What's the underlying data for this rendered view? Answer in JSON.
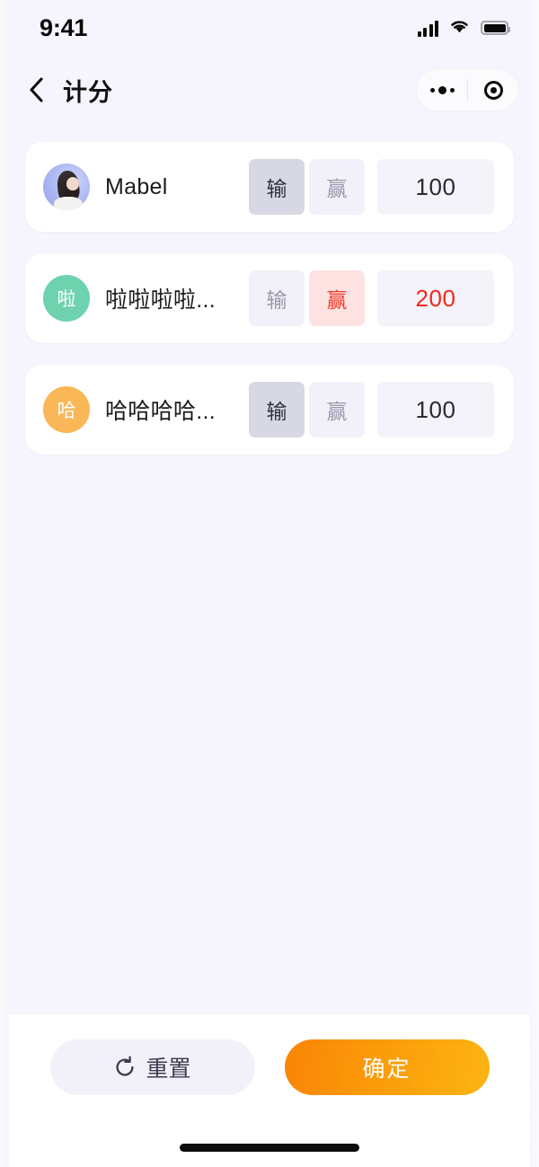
{
  "status_bar": {
    "time": "9:41",
    "cellular_icon": "signal-bars-icon",
    "wifi_icon": "wifi-icon",
    "battery_icon": "battery-full-icon"
  },
  "nav": {
    "back_icon": "chevron-left-icon",
    "title": "计分",
    "capsule": {
      "more_icon": "more-dots-icon",
      "target_icon": "target-circle-icon"
    }
  },
  "colors": {
    "page_bg": "#f6f5fd",
    "card_bg": "#ffffff",
    "accent_orange_start": "#f98407",
    "accent_orange_end": "#fcb413",
    "win_red": "#f3281c",
    "win_red_bg": "#fce3e1",
    "toggle_selected_bg": "#d7d8e3",
    "toggle_idle_bg": "#f2f1f9",
    "score_field_bg": "#f4f3fa"
  },
  "toggle_labels": {
    "lose": "输",
    "win": "赢"
  },
  "players": [
    {
      "avatar_type": "photo",
      "avatar_initial": "",
      "avatar_color": "#aab6f2",
      "name": "Mabel",
      "result": "lose",
      "score": "100",
      "score_state": "neutral"
    },
    {
      "avatar_type": "initial",
      "avatar_initial": "啦",
      "avatar_color": "#6ed2ae",
      "name": "啦啦啦啦...",
      "result": "win",
      "score": "200",
      "score_state": "win"
    },
    {
      "avatar_type": "initial",
      "avatar_initial": "哈",
      "avatar_color": "#f9b758",
      "name": "哈哈哈哈...",
      "result": "lose",
      "score": "100",
      "score_state": "neutral"
    }
  ],
  "footer": {
    "reset_label": "重置",
    "reset_icon": "refresh-ccw-icon",
    "confirm_label": "确定",
    "home_indicator": "home-indicator"
  }
}
